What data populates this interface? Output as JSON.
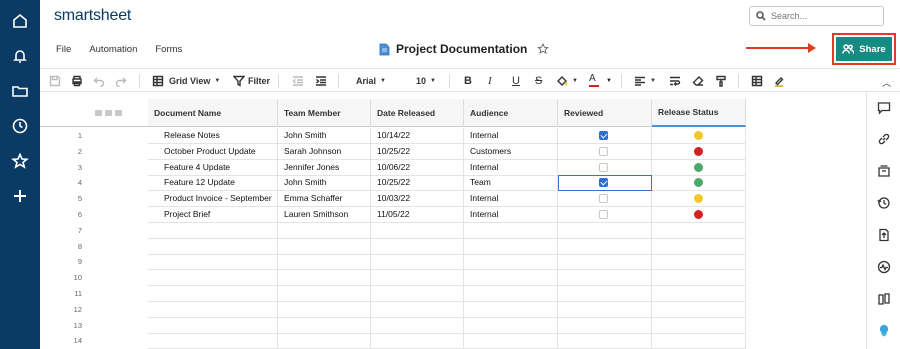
{
  "app": {
    "brand": "smartsheet"
  },
  "search": {
    "placeholder": "Search..."
  },
  "menu": [
    "File",
    "Automation",
    "Forms"
  ],
  "document": {
    "title": "Project Documentation"
  },
  "share": {
    "label": "Share"
  },
  "toolbar": {
    "view_label": "Grid View",
    "filter_label": "Filter",
    "font": "Arial",
    "font_size": "10",
    "bold": "B",
    "italic": "I",
    "underline": "U",
    "strike": "S",
    "text_color": "A"
  },
  "columns": [
    "Document Name",
    "Team Member",
    "Date Released",
    "Audience",
    "Reviewed",
    "Release Status"
  ],
  "rows": [
    {
      "num": "1",
      "doc": "Release Notes",
      "member": "John Smith",
      "date": "10/14/22",
      "audience": "Internal",
      "reviewed": true,
      "status": "yellow"
    },
    {
      "num": "2",
      "doc": "October Product Update",
      "member": "Sarah Johnson",
      "date": "10/25/22",
      "audience": "Customers",
      "reviewed": false,
      "status": "red"
    },
    {
      "num": "3",
      "doc": "Feature 4 Update",
      "member": "Jennifer Jones",
      "date": "10/06/22",
      "audience": "Internal",
      "reviewed": false,
      "status": "green"
    },
    {
      "num": "4",
      "doc": "Feature 12 Update",
      "member": "John Smith",
      "date": "10/25/22",
      "audience": "Team",
      "reviewed": true,
      "status": "green"
    },
    {
      "num": "5",
      "doc": "Product Invoice - September",
      "member": "Emma Schaffer",
      "date": "10/03/22",
      "audience": "Internal",
      "reviewed": false,
      "status": "yellow"
    },
    {
      "num": "6",
      "doc": "Project Brief",
      "member": "Lauren Smithson",
      "date": "11/05/22",
      "audience": "Internal",
      "reviewed": false,
      "status": "red"
    },
    {
      "num": "7"
    },
    {
      "num": "8"
    },
    {
      "num": "9"
    },
    {
      "num": "10"
    },
    {
      "num": "11"
    },
    {
      "num": "12"
    },
    {
      "num": "13"
    },
    {
      "num": "14"
    }
  ],
  "status_colors": {
    "yellow": "#f2c72c",
    "red": "#d32124",
    "green": "#4ca868"
  },
  "colors": {
    "nav": "#0b3a64",
    "share": "#168b82",
    "highlight": "#e23b25"
  }
}
